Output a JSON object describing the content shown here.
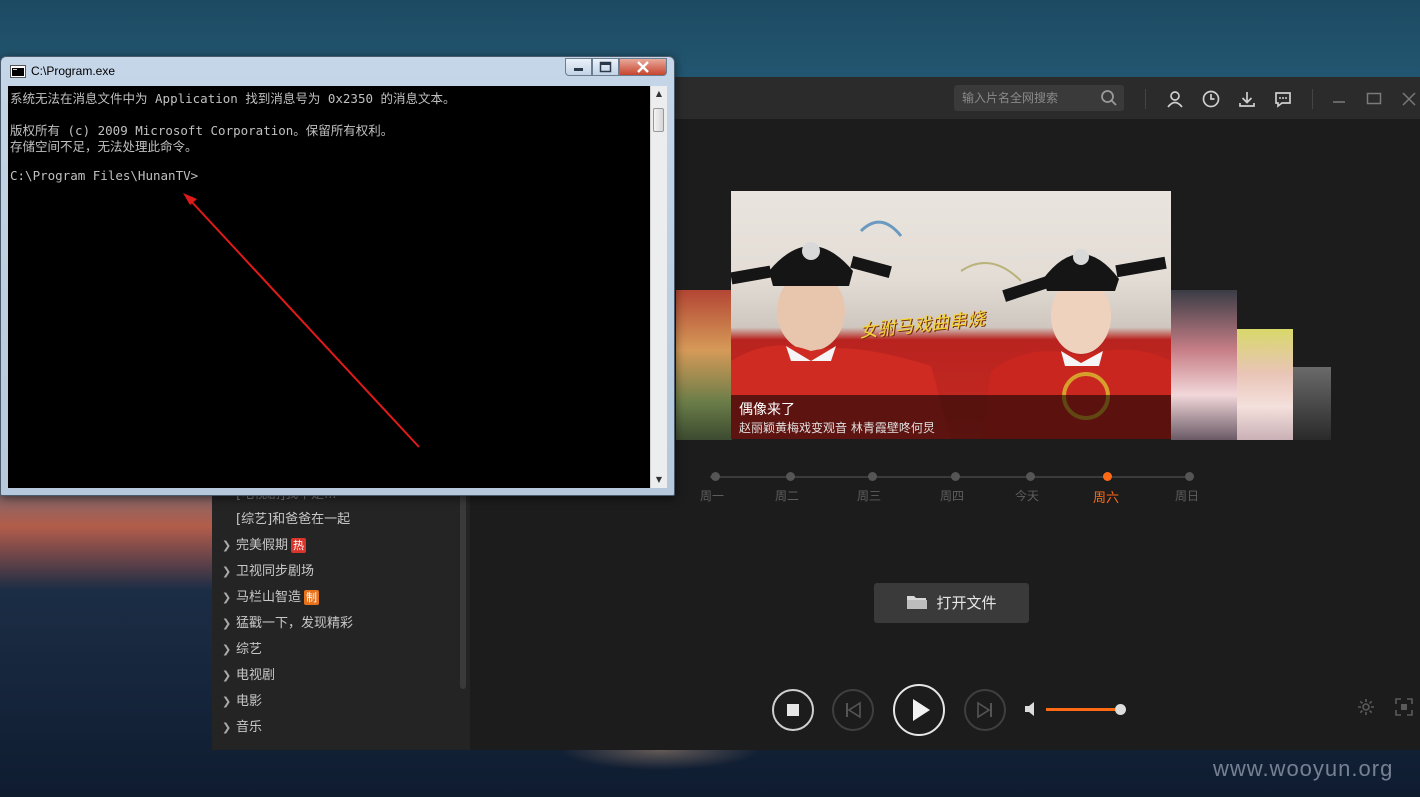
{
  "console": {
    "title": "C:\\Program.exe",
    "lines": [
      "系统无法在消息文件中为 Application 找到消息号为 0x2350 的消息文本。",
      "",
      "版权所有 (c) 2009 Microsoft Corporation。保留所有权利。",
      "存储空间不足，无法处理此命令。",
      "",
      "C:\\Program Files\\HunanTV>"
    ]
  },
  "player": {
    "search": {
      "placeholder": "输入片名全网搜索"
    },
    "sidebar": {
      "items": [
        {
          "label": "[电视剧]我不是...",
          "chevron": false
        },
        {
          "label": "[综艺]和爸爸在一起",
          "chevron": false
        },
        {
          "label": "完美假期",
          "chevron": true,
          "badge": "热",
          "badge_color": "#d9342b"
        },
        {
          "label": "卫视同步剧场",
          "chevron": true
        },
        {
          "label": "马栏山智造",
          "chevron": true,
          "badge": "制",
          "badge_color": "#e8721c"
        },
        {
          "label": "猛戳一下，发现精彩",
          "chevron": true
        },
        {
          "label": "综艺",
          "chevron": true
        },
        {
          "label": "电视剧",
          "chevron": true
        },
        {
          "label": "电影",
          "chevron": true
        },
        {
          "label": "音乐",
          "chevron": true
        }
      ]
    },
    "featured": {
      "title": "偶像来了",
      "subtitle": "赵丽颖黄梅戏变观音 林青霞壁咚何炅",
      "overlay_text": "女驸马戏曲串烧"
    },
    "timeline": {
      "days": [
        "周一",
        "周二",
        "周三",
        "周四",
        "今天",
        "周六",
        "周日"
      ],
      "active_index": 5
    },
    "open_file_label": "打开文件",
    "volume_level": 0.85,
    "accent_color": "#ff6a14"
  },
  "watermark": "www.wooyun.org"
}
